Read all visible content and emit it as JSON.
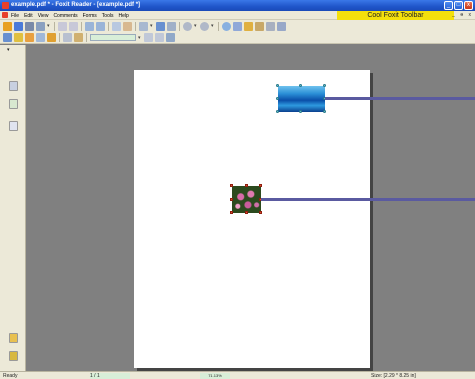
{
  "window": {
    "title": "example.pdf * - Foxit Reader - [example.pdf *]",
    "minimize": "_",
    "maximize": "□",
    "close": "x"
  },
  "menubar": {
    "items": [
      "File",
      "Edit",
      "View",
      "Comments",
      "Forms",
      "Tools",
      "Help"
    ],
    "cool_toolbar": "Cool Foxit Toolbar",
    "mdi_controls": "_ ɵ x"
  },
  "toolbar1": {
    "buttons": [
      "open-icon",
      "save-icon",
      "print-icon",
      "email-icon",
      "undo-icon",
      "redo-icon",
      "back-icon",
      "forward-icon",
      "select-text-icon",
      "hand-icon",
      "zoom-icon",
      "fit-page-icon",
      "fit-width-icon",
      "zoom-out-icon",
      "zoom-in-icon",
      "rotate-icon",
      "chart-icon",
      "highlight-icon",
      "book-icon",
      "typewriter-icon",
      "image-icon"
    ]
  },
  "toolbar2": {
    "buttons": [
      "note-icon",
      "text-icon",
      "comment-icon",
      "edit-icon",
      "grid-icon",
      "find-icon",
      "search-icon"
    ],
    "page_value": ""
  },
  "status": {
    "ready": "Ready",
    "page": "1 / 1",
    "zoom": "71.13%",
    "size": "Size: [2.29 * 8.25 in]"
  },
  "colors": {
    "title_blue": "#1f55c9",
    "toolbar_bg": "#ece9d8",
    "cool_toolbar_yellow": "#f4e00c",
    "workspace_gray": "#808080",
    "link_line": "#5a5aa0"
  }
}
